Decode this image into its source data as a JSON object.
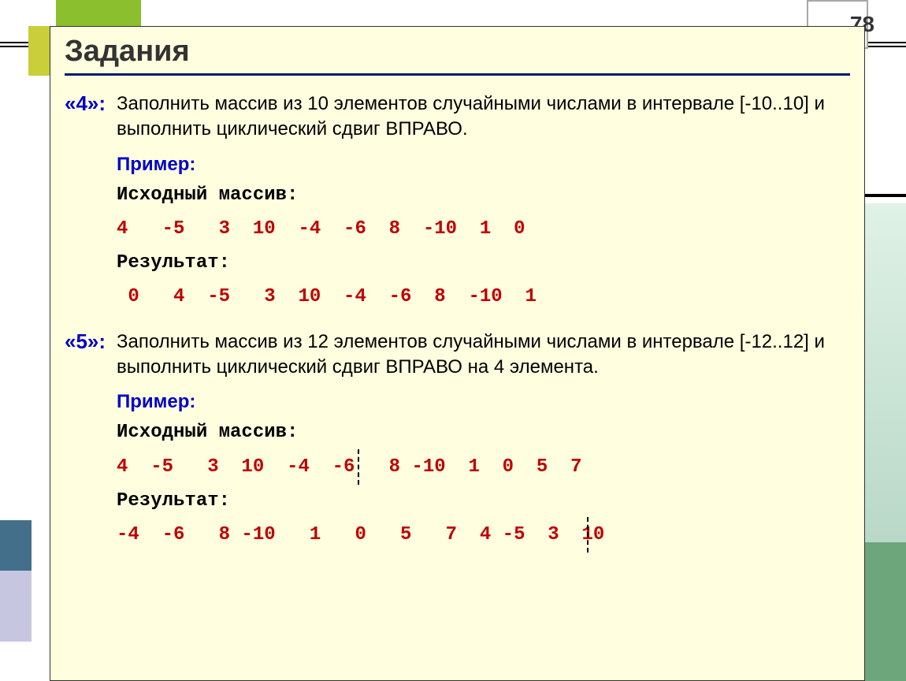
{
  "page_number": "78",
  "title": "Задания",
  "task4": {
    "grade_label": "«4»:",
    "description": "Заполнить массив из 10 элементов случайными числами в интервале [-10..10] и выполнить циклический сдвиг ВПРАВО.",
    "example_label": "Пример:",
    "source_label": "Исходный массив:",
    "source_values": "4   -5   3  10  -4  -6  8  -10  1  0",
    "result_label": "Результат:",
    "result_values": " 0   4  -5   3  10  -4  -6  8  -10  1"
  },
  "task5": {
    "grade_label": "«5»:",
    "description": "Заполнить массив из 12 элементов случайными числами в интервале [-12..12] и выполнить циклический сдвиг ВПРАВО на 4 элемента.",
    "example_label": "Пример:",
    "source_label": "Исходный массив:",
    "source_values": "4  -5   3  10  -4  -6   8 -10  1  0  5  7",
    "result_label": "Результат:",
    "result_values": "-4  -6   8 -10   1   0   5   7  4 -5  3  10"
  }
}
